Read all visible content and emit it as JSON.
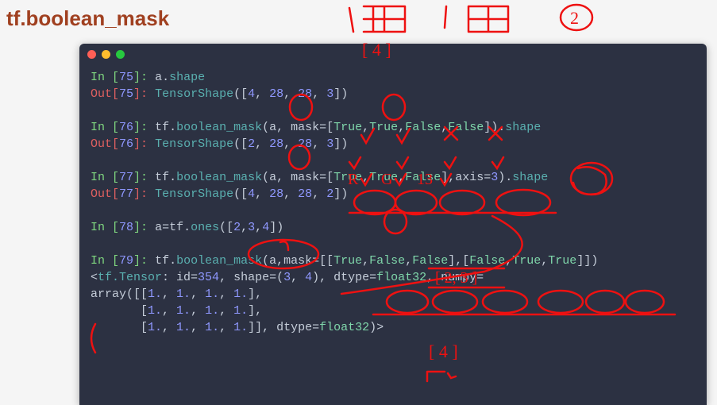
{
  "header": {
    "title": "tf.boolean_mask"
  },
  "terminal": {
    "lines": [
      {
        "type": "in",
        "n": "75",
        "code": [
          "a",
          ".",
          "shape"
        ]
      },
      {
        "type": "out",
        "n": "75",
        "code": [
          "TensorShape",
          "([",
          "4",
          ", ",
          "28",
          ", ",
          "28",
          ", ",
          "3",
          "])"
        ]
      },
      {
        "type": "blank"
      },
      {
        "type": "in",
        "n": "76",
        "code": [
          "tf",
          ".",
          "boolean_mask",
          "(a, mask=[",
          "True",
          ",",
          "True",
          ",",
          "False",
          ",",
          "False",
          "])",
          ".",
          "shape"
        ]
      },
      {
        "type": "out",
        "n": "76",
        "code": [
          "TensorShape",
          "([",
          "2",
          ", ",
          "28",
          ", ",
          "28",
          ", ",
          "3",
          "])"
        ]
      },
      {
        "type": "blank"
      },
      {
        "type": "in",
        "n": "77",
        "code": [
          "tf",
          ".",
          "boolean_mask",
          "(a, mask=[",
          "True",
          ",",
          "True",
          ",",
          "False",
          "],axis=",
          "3",
          ")",
          ".",
          "shape"
        ]
      },
      {
        "type": "out",
        "n": "77",
        "code": [
          "TensorShape",
          "([",
          "4",
          ", ",
          "28",
          ", ",
          "28",
          ", ",
          "2",
          "])"
        ]
      },
      {
        "type": "blank"
      },
      {
        "type": "in",
        "n": "78",
        "code": [
          "a=tf",
          ".",
          "ones",
          "([",
          "2",
          ",",
          "3",
          ",",
          "4",
          "])"
        ]
      },
      {
        "type": "blank"
      },
      {
        "type": "in",
        "n": "79",
        "code": [
          "tf",
          ".",
          "boolean_mask",
          "(a,mask=[[",
          "True",
          ",",
          "False",
          ",",
          "False",
          "],[",
          "False",
          ",",
          "True",
          ",",
          "True",
          "]])"
        ]
      },
      {
        "type": "plain",
        "text": "<tf.Tensor: id=354, shape=(3, 4), dtype=float32, numpy="
      },
      {
        "type": "plain",
        "text": "array([[1., 1., 1., 1.],"
      },
      {
        "type": "plain",
        "text": "       [1., 1., 1., 1.],"
      },
      {
        "type": "plain",
        "text": "       [1., 1., 1., 1.]], dtype=float32)>"
      }
    ]
  },
  "annotations": {
    "color": "#e11",
    "handwritten": [
      "[4]",
      "[2,3]",
      "[4]",
      "R",
      "G",
      "13",
      "2"
    ],
    "circles": 18
  }
}
